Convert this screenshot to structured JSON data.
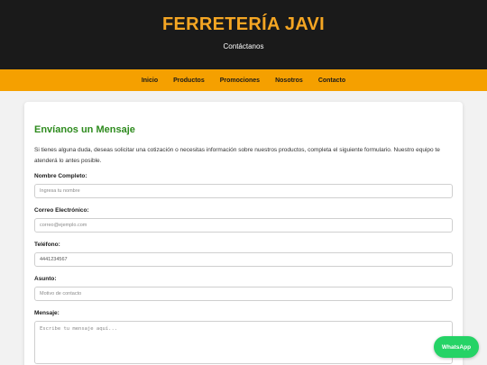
{
  "header": {
    "brand": "FERRETERÍA JAVI",
    "subtitle": "Contáctanos"
  },
  "nav": {
    "items": [
      {
        "label": "Inicio"
      },
      {
        "label": "Productos"
      },
      {
        "label": "Promociones"
      },
      {
        "label": "Nosotros"
      },
      {
        "label": "Contacto"
      }
    ]
  },
  "form": {
    "title": "Envíanos un Mensaje",
    "intro": "Si tienes alguna duda, deseas solicitar una cotización o necesitas información sobre nuestros productos, completa el siguiente formulario. Nuestro equipo te atenderá lo antes posible.",
    "name": {
      "label": "Nombre Completo:",
      "placeholder": "Ingresa tu nombre",
      "value": ""
    },
    "email": {
      "label": "Correo Electrónico:",
      "placeholder": "correo@ejemplo.com",
      "value": ""
    },
    "phone": {
      "label": "Teléfono:",
      "placeholder": "",
      "value": "4441234567"
    },
    "subject": {
      "label": "Asunto:",
      "placeholder": "Motivo de contacto",
      "value": ""
    },
    "message": {
      "label": "Mensaje:",
      "placeholder": "Escribe tu mensaje aquí...",
      "value": ""
    }
  },
  "whatsapp": {
    "label": "WhatsApp"
  },
  "colors": {
    "header_bg": "#1a1a1a",
    "brand": "#f5a623",
    "nav_bg": "#f5a000",
    "form_title": "#2e8b1e",
    "whatsapp": "#25d366"
  }
}
